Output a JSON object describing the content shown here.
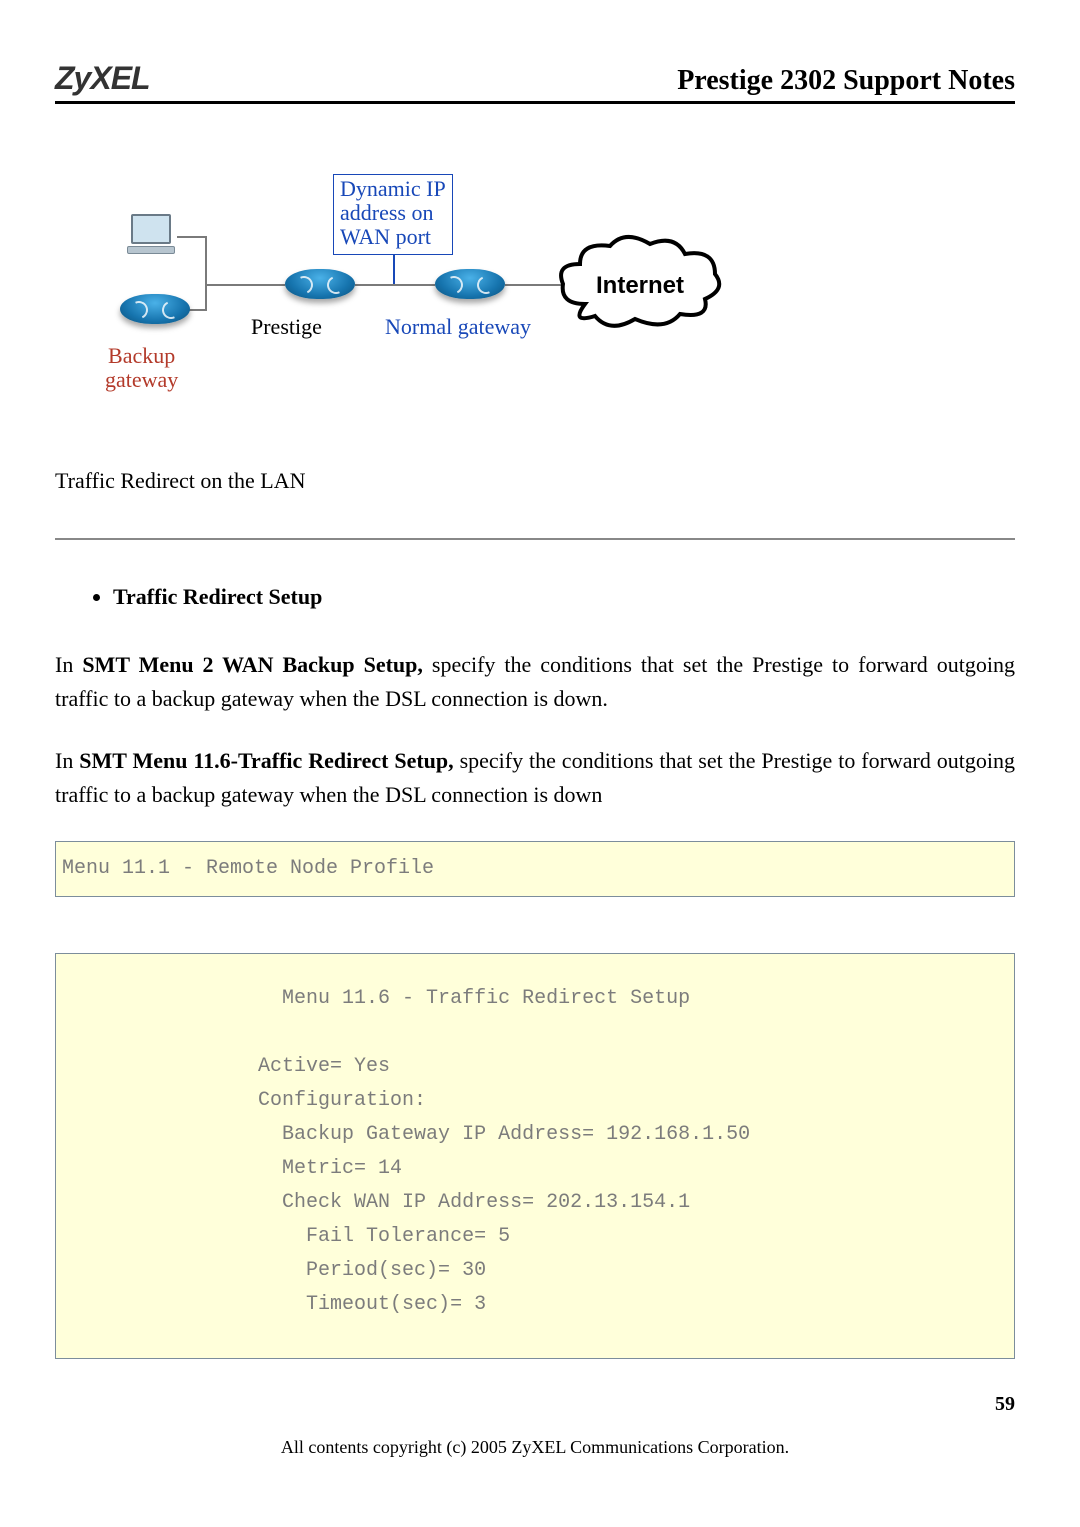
{
  "header": {
    "logo": "ZyXEL",
    "title": "Prestige 2302 Support Notes"
  },
  "diagram": {
    "dynamic_box_l1": "Dynamic IP",
    "dynamic_box_l2": "address on",
    "dynamic_box_l3": "WAN port",
    "prestige": "Prestige",
    "normal_gateway": "Normal gateway",
    "backup_l1": "Backup",
    "backup_l2": "gateway",
    "internet": "Internet"
  },
  "text": {
    "heading": "Traffic Redirect on the LAN",
    "bullet1": "Traffic Redirect Setup",
    "p1_pre": "In ",
    "p1_b": "SMT Menu 2 WAN Backup Setup,",
    "p1_post": " specify the conditions that set the Prestige to forward outgoing traffic to a backup gateway when the DSL connection is down.",
    "p2_pre": "In ",
    "p2_b": "SMT Menu 11.6-Traffic Redirect Setup,",
    "p2_post": " specify the conditions that set the Prestige to forward outgoing traffic to a backup gateway when the DSL connection is down",
    "code1": "Menu 11.1 - Remote Node Profile",
    "menu_title": "                  Menu 11.6 - Traffic Redirect Setup",
    "menu_active": "                Active= Yes",
    "menu_config": "                Configuration:",
    "menu_backup_ip": "                  Backup Gateway IP Address= 192.168.1.50",
    "menu_metric": "                  Metric= 14",
    "menu_check_ip": "                  Check WAN IP Address= 202.13.154.1",
    "menu_fail_tol": "                    Fail Tolerance= 5",
    "menu_period": "                    Period(sec)= 30",
    "menu_timeout": "                    Timeout(sec)= 3"
  },
  "footer": {
    "page": "59",
    "copyright": "All contents copyright (c) 2005 ZyXEL Communications Corporation."
  }
}
